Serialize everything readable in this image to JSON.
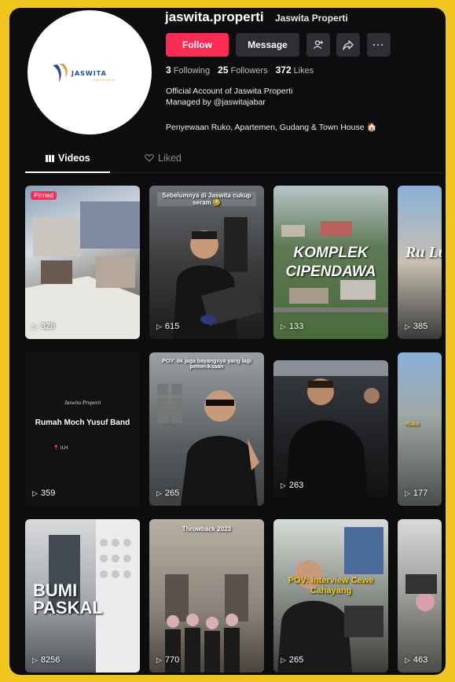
{
  "profile": {
    "username": "jaswita.properti",
    "display_name": "Jaswita Properti",
    "logo_text": "JASWITA",
    "logo_sub": "PROPERTI",
    "follow_label": "Follow",
    "message_label": "Message",
    "following_count": "3",
    "following_label": "Following",
    "followers_count": "25",
    "followers_label": "Followers",
    "likes_count": "372",
    "likes_label": "Likes",
    "bio_line1": "Official Account of Jaswita Properti",
    "bio_line2": "Managed by @jaswitajabar",
    "bio_line3": "Penyewaan Ruko, Apartemen, Gudang & Town House 🏠"
  },
  "tabs": {
    "videos": "Videos",
    "liked": "Liked"
  },
  "videos": [
    {
      "views": "328",
      "pinned": "Pinned"
    },
    {
      "views": "615",
      "overlay": "Sebelumnya di Jaswita cukup seram 😂"
    },
    {
      "views": "133",
      "overlay": "KOMPLEK CIPENDAWA"
    },
    {
      "views": "385",
      "overlay": "Ru Lu"
    },
    {
      "views": "359",
      "overlay_top": "Jaswita Properti",
      "overlay": "Rumah Moch Yusuf Band",
      "overlay_sub": "📍 ILH"
    },
    {
      "views": "265",
      "overlay": "POV: ok jaga bayangnya yang lagi pemeriksaan"
    },
    {
      "views": "263"
    },
    {
      "views": "177",
      "overlay": "Ruko"
    },
    {
      "views": "8256",
      "overlay": "BUMI PASKAL"
    },
    {
      "views": "770",
      "overlay": "Throwback 2023"
    },
    {
      "views": "265",
      "overlay": "POV: Interview Cewe Cahayang"
    },
    {
      "views": "463"
    }
  ],
  "colors": {
    "accent": "#fe2c55",
    "background": "#0d0d0f",
    "frame": "#f0c51e"
  }
}
